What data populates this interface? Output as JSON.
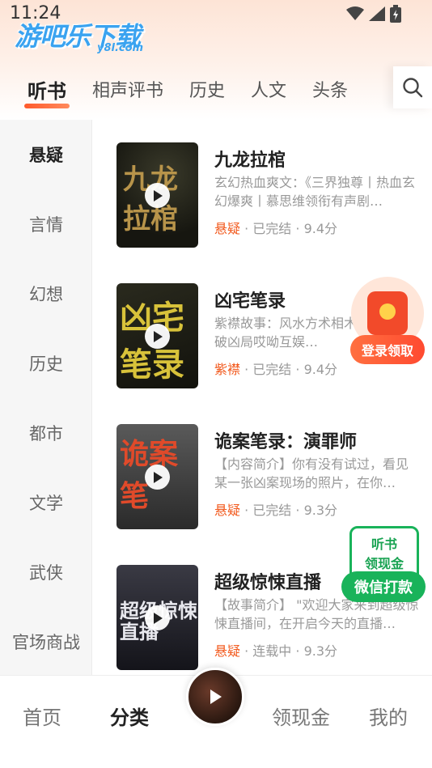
{
  "status_bar": {
    "time": "11:24"
  },
  "logo": {
    "main": "游吧乐下载",
    "sub": "y8l.com"
  },
  "top_tabs": [
    {
      "label": "听书",
      "active": true
    },
    {
      "label": "相声评书",
      "active": false
    },
    {
      "label": "历史",
      "active": false
    },
    {
      "label": "人文",
      "active": false
    },
    {
      "label": "头条",
      "active": false
    }
  ],
  "categories": [
    {
      "label": "悬疑",
      "active": true
    },
    {
      "label": "言情",
      "active": false
    },
    {
      "label": "幻想",
      "active": false
    },
    {
      "label": "历史",
      "active": false
    },
    {
      "label": "都市",
      "active": false
    },
    {
      "label": "文学",
      "active": false
    },
    {
      "label": "武侠",
      "active": false
    },
    {
      "label": "官场商战",
      "active": false
    }
  ],
  "books": [
    {
      "title": "九龙拉棺",
      "description": "玄幻热血爽文：《三界独尊丨热血玄幻爆爽丨慕思维领衔有声剧…",
      "tag": "悬疑",
      "status": "已完结",
      "rating": "9.4分",
      "cover_text": "九龙拉棺"
    },
    {
      "title": "凶宅笔录",
      "description": "紫襟故事：风水方术相术…邪捉鬼破凶局哎呦互娱…",
      "tag": "紫襟",
      "status": "已完结",
      "rating": "9.4分",
      "cover_text": "凶宅笔录"
    },
    {
      "title": "诡案笔录：演罪师",
      "description": "【内容简介】你有没有试过，看见某一张凶案现场的照片，在你…",
      "tag": "悬疑",
      "status": "已完结",
      "rating": "9.3分",
      "cover_text": "诡案笔"
    },
    {
      "title": "超级惊悚直播",
      "description": "【故事简介】 \"欢迎大家来到超级惊悚直播间，在开启今天的直播…",
      "tag": "悬疑",
      "status": "连载中",
      "rating": "9.3分",
      "cover_text": "超级惊悚直播"
    }
  ],
  "meta_separator": " · ",
  "promo_redpacket": {
    "label": "登录领取"
  },
  "promo_wechat": {
    "line1": "听书",
    "line2": "领现金",
    "button": "微信打款"
  },
  "bottom_nav": [
    {
      "label": "首页",
      "active": false
    },
    {
      "label": "分类",
      "active": true
    },
    {
      "label": "领现金",
      "active": false
    },
    {
      "label": "我的",
      "active": false
    }
  ],
  "colors": {
    "accent": "#f25a1e",
    "wechat_green": "#19b35a"
  }
}
